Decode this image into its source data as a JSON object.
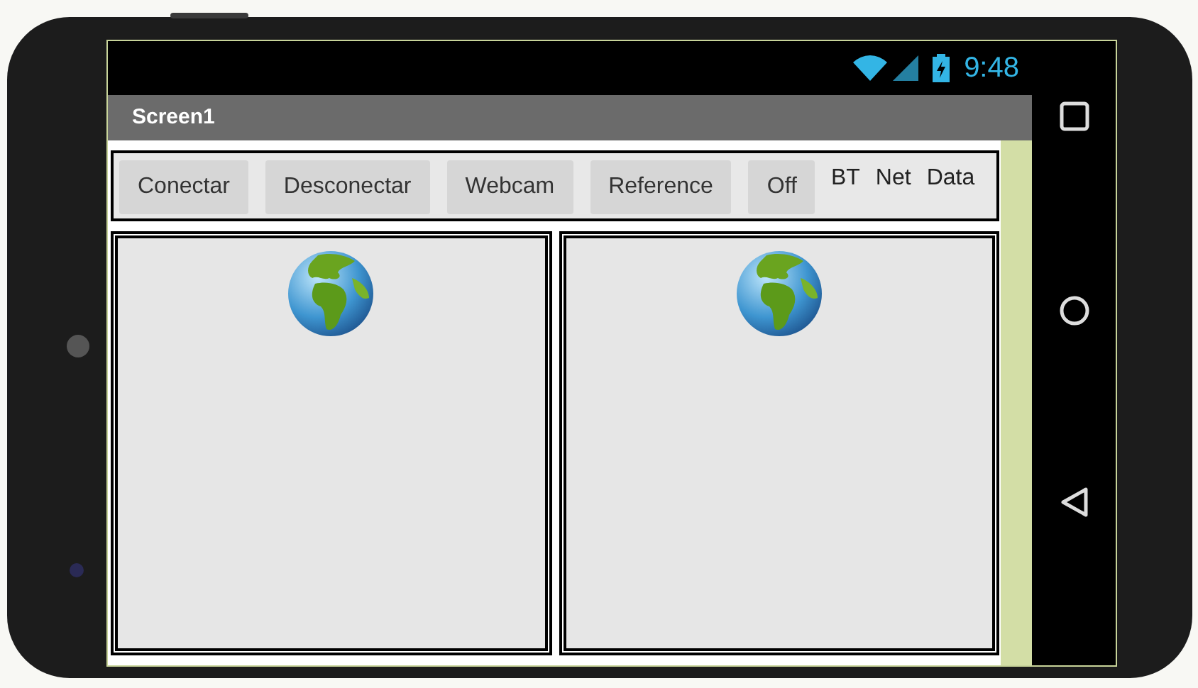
{
  "status_bar": {
    "time": "9:48"
  },
  "title_bar": {
    "title": "Screen1"
  },
  "toolbar": {
    "buttons": [
      "Conectar",
      "Desconectar",
      "Webcam",
      "Reference",
      "Off"
    ],
    "labels": [
      "BT",
      "Net",
      "Data"
    ]
  }
}
